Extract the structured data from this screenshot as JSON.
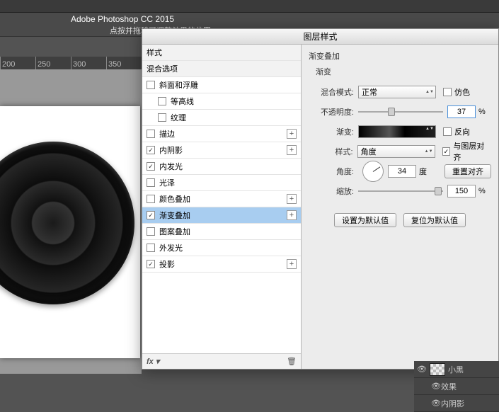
{
  "app": {
    "title": "Adobe Photoshop CC 2015",
    "hint": "点按并拖移可调整效果的位置"
  },
  "ruler": [
    "200",
    "250",
    "300",
    "350"
  ],
  "dialog": {
    "title": "图层样式",
    "left": {
      "styles_header": "样式",
      "blend_header": "混合选项",
      "items": [
        {
          "label": "斜面和浮雕",
          "checked": false,
          "plus": false
        },
        {
          "label": "等高线",
          "checked": false,
          "indent": true
        },
        {
          "label": "纹理",
          "checked": false,
          "indent": true
        },
        {
          "label": "描边",
          "checked": false,
          "plus": true
        },
        {
          "label": "内阴影",
          "checked": true,
          "plus": true
        },
        {
          "label": "内发光",
          "checked": true
        },
        {
          "label": "光泽",
          "checked": false
        },
        {
          "label": "颜色叠加",
          "checked": false,
          "plus": true
        },
        {
          "label": "渐变叠加",
          "checked": true,
          "plus": true,
          "selected": true
        },
        {
          "label": "图案叠加",
          "checked": false
        },
        {
          "label": "外发光",
          "checked": false
        },
        {
          "label": "投影",
          "checked": true,
          "plus": true
        }
      ],
      "footer_fx": "fx"
    },
    "right": {
      "group": "渐变叠加",
      "subgroup": "渐变",
      "blend_mode_label": "混合模式:",
      "blend_mode_value": "正常",
      "dither_label": "仿色",
      "dither_checked": false,
      "opacity_label": "不透明度:",
      "opacity_value": "37",
      "opacity_unit": "%",
      "gradient_label": "渐变:",
      "reverse_label": "反向",
      "reverse_checked": false,
      "style_label": "样式:",
      "style_value": "角度",
      "align_label": "与图层对齐",
      "align_checked": true,
      "angle_label": "角度:",
      "angle_value": "34",
      "angle_unit": "度",
      "reset_align": "重置对齐",
      "scale_label": "缩放:",
      "scale_value": "150",
      "scale_unit": "%",
      "make_default": "设置为默认值",
      "reset_default": "复位为默认值"
    }
  },
  "layers": {
    "name": "小黑",
    "fx_label": "效果",
    "inner_shadow": "内阴影"
  }
}
